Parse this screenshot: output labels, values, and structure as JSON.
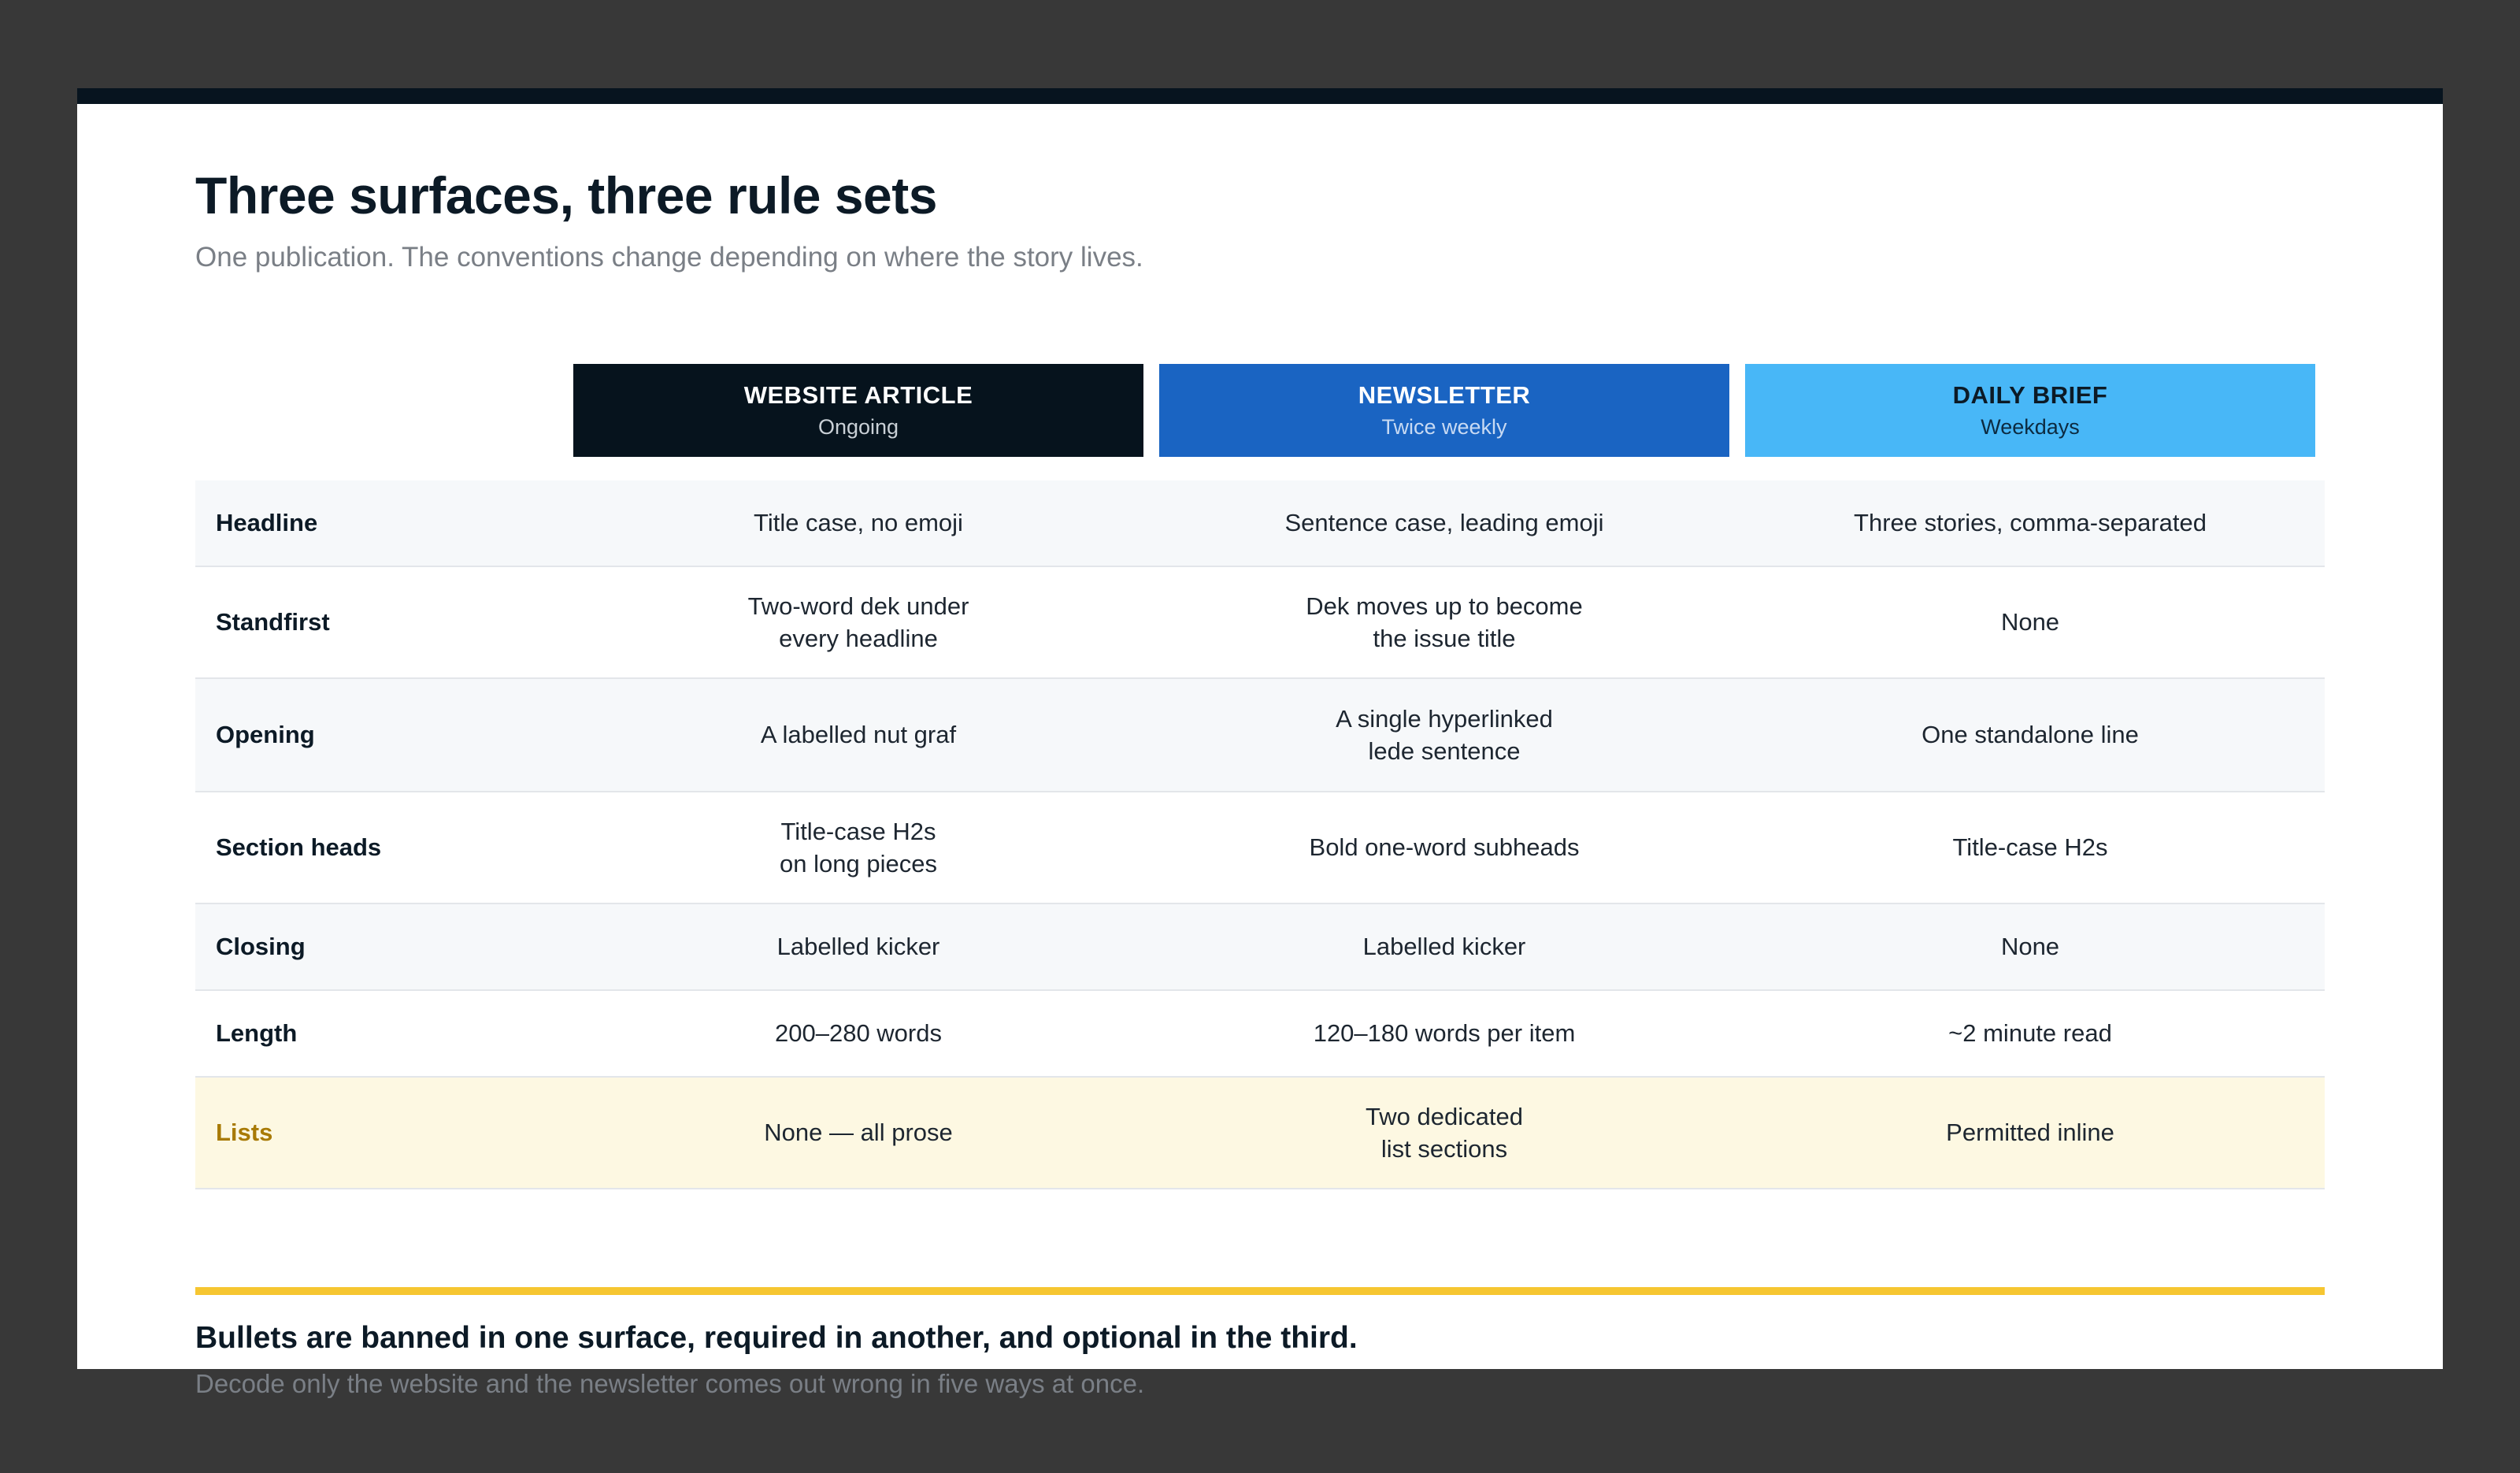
{
  "page": {
    "title": "Three surfaces, three rule sets",
    "subtitle": "One publication. The conventions change depending on where the story lives."
  },
  "columns": [
    {
      "title": "WEBSITE ARTICLE",
      "subtitle": "Ongoing",
      "color": "#06131d"
    },
    {
      "title": "NEWSLETTER",
      "subtitle": "Twice weekly",
      "color": "#1a64c2"
    },
    {
      "title": "DAILY BRIEF",
      "subtitle": "Weekdays",
      "color": "#48b7f7"
    }
  ],
  "rows": [
    {
      "label": "Headline",
      "values": [
        "Title case, no emoji",
        "Sentence case, leading emoji",
        "Three stories, comma-separated"
      ]
    },
    {
      "label": "Standfirst",
      "values": [
        "Two-word dek under\nevery headline",
        "Dek moves up to become\nthe issue title",
        "None"
      ]
    },
    {
      "label": "Opening",
      "values": [
        "A labelled nut graf",
        "A single hyperlinked\nlede sentence",
        "One standalone line"
      ]
    },
    {
      "label": "Section heads",
      "values": [
        "Title-case H2s\non long pieces",
        "Bold one-word subheads",
        "Title-case H2s"
      ]
    },
    {
      "label": "Closing",
      "values": [
        "Labelled kicker",
        "Labelled kicker",
        "None"
      ]
    },
    {
      "label": "Length",
      "values": [
        "200–280 words",
        "120–180 words per item",
        "~2 minute read"
      ]
    },
    {
      "label": "Lists",
      "values": [
        "None — all prose",
        "Two dedicated\nlist sections",
        "Permitted inline"
      ]
    }
  ],
  "footer": {
    "title": "Bullets are banned in one surface, required in another, and optional in the third.",
    "subtitle": "Decode only the website and the newsletter comes out wrong in five ways at once."
  },
  "colors": {
    "background": "#383838",
    "accent": "#f6c631",
    "highlight_label": "#a87a05"
  }
}
